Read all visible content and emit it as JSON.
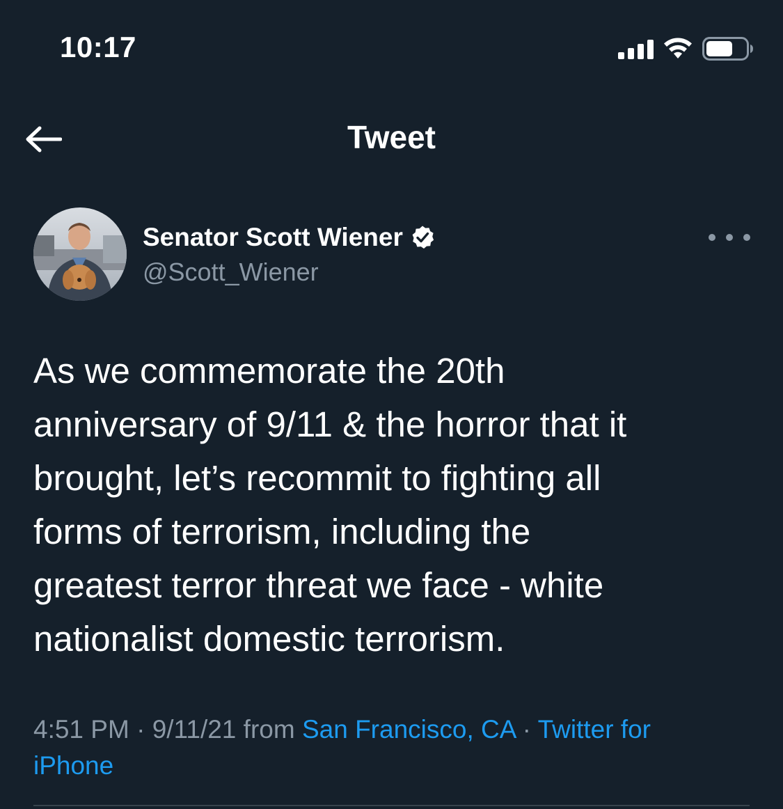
{
  "status_bar": {
    "time": "10:17"
  },
  "header": {
    "title": "Tweet",
    "back_icon": "arrow-left-icon"
  },
  "author": {
    "name": "Senator Scott Wiener",
    "handle": "@Scott_Wiener",
    "verified": true
  },
  "tweet": {
    "lines": [
      "As we commemorate the 20th",
      "anniversary of 9/11 & the horror that it",
      "brought, let’s recommit to fighting all",
      "forms of terrorism, including the",
      "greatest terror threat we face - white",
      "nationalist domestic terrorism."
    ]
  },
  "meta": {
    "time": "4:51 PM",
    "sep1": " · ",
    "date": "9/11/21",
    "from": " from ",
    "location": "San Francisco, CA",
    "sep2": " · ",
    "source_part1": "Twitter for",
    "source_part2": "iPhone"
  },
  "colors": {
    "background": "#15202b",
    "link": "#1d9bf0",
    "secondary_text": "#8b98a5",
    "divider": "#38444d"
  }
}
